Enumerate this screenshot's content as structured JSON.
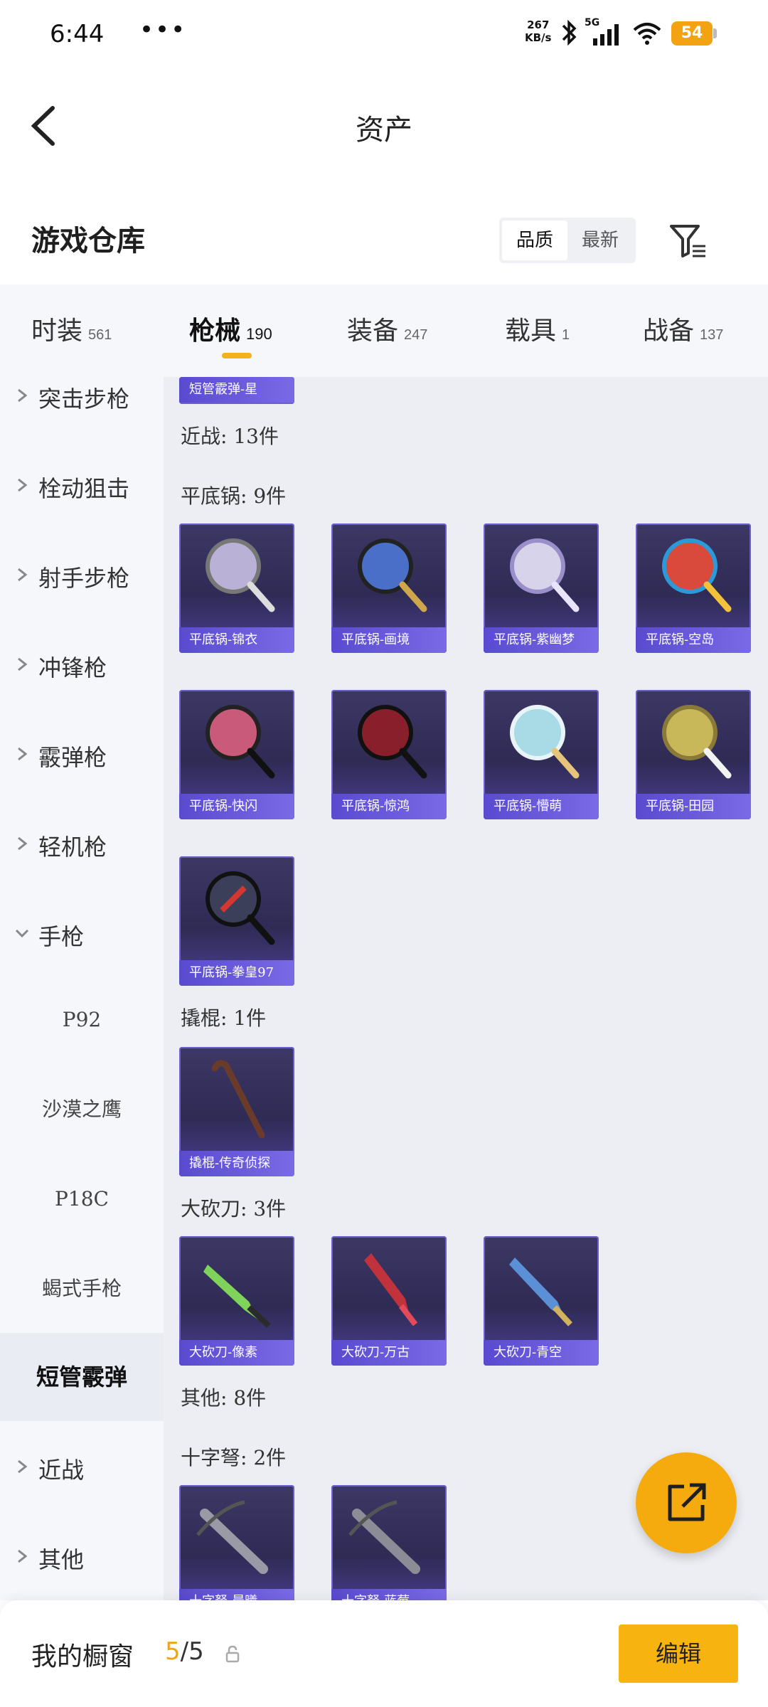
{
  "status_bar": {
    "time": "6:44",
    "more": "•••",
    "net_speed_value": "267",
    "net_speed_unit": "KB/s",
    "network": "5G",
    "wifi_level": "6",
    "battery": "54"
  },
  "header": {
    "title": "资产"
  },
  "warehouse": {
    "title": "游戏仓库",
    "sort_options": [
      "品质",
      "最新"
    ],
    "active_sort": "品质"
  },
  "tabs": [
    {
      "label": "时装",
      "count": "561"
    },
    {
      "label": "枪械",
      "count": "190",
      "active": true
    },
    {
      "label": "装备",
      "count": "247"
    },
    {
      "label": "载具",
      "count": "1"
    },
    {
      "label": "战备",
      "count": "137"
    }
  ],
  "sidebar": {
    "categories": [
      "突击步枪",
      "栓动狙击",
      "射手步枪",
      "冲锋枪",
      "霰弹枪",
      "轻机枪",
      "手枪"
    ],
    "pistol_sub": [
      "P92",
      "沙漠之鹰",
      "P18C",
      "蝎式手枪"
    ],
    "selected": "短管霰弹",
    "after": [
      "近战",
      "其他"
    ]
  },
  "content": {
    "partial_card_label": "短管霰弹-星",
    "melee_label": "近战: 13件",
    "pan_label": "平底锅: 9件",
    "pans": [
      {
        "name": "平底锅-锦衣",
        "color": "#b9b2d6"
      },
      {
        "name": "平底锅-画境",
        "color": "#4a6fc9"
      },
      {
        "name": "平底锅-紫幽梦",
        "color": "#d7d3ea"
      },
      {
        "name": "平底锅-空岛",
        "color": "#d94a3c"
      },
      {
        "name": "平底锅-快闪",
        "color": "#c95a7a"
      },
      {
        "name": "平底锅-惊鸿",
        "color": "#8a1f2c"
      },
      {
        "name": "平底锅-懵萌",
        "color": "#a9dbe6"
      },
      {
        "name": "平底锅-田园",
        "color": "#c9b85a"
      },
      {
        "name": "平底锅-拳皇97",
        "color": "#3b3f5a"
      }
    ],
    "crowbar_label": "撬棍: 1件",
    "crowbars": [
      {
        "name": "撬棍-传奇侦探",
        "color": "#6a3a2a"
      }
    ],
    "machete_label": "大砍刀: 3件",
    "machetes": [
      {
        "name": "大砍刀-像素",
        "color": "#7fd35a"
      },
      {
        "name": "大砍刀-万古",
        "color": "#c0323c"
      },
      {
        "name": "大砍刀-青空",
        "color": "#5b8fd6"
      }
    ],
    "other_label": "其他: 8件",
    "crossbow_label": "十字弩: 2件",
    "crossbows": [
      {
        "name": "十字弩-晨曦",
        "color": "#9a9aa6"
      },
      {
        "name": "十字弩-蓝莓",
        "color": "#8c8c96"
      }
    ]
  },
  "bottom_bar": {
    "title": "我的橱窗",
    "count_current": "5",
    "count_sep_total": "/5",
    "edit_label": "编辑"
  }
}
